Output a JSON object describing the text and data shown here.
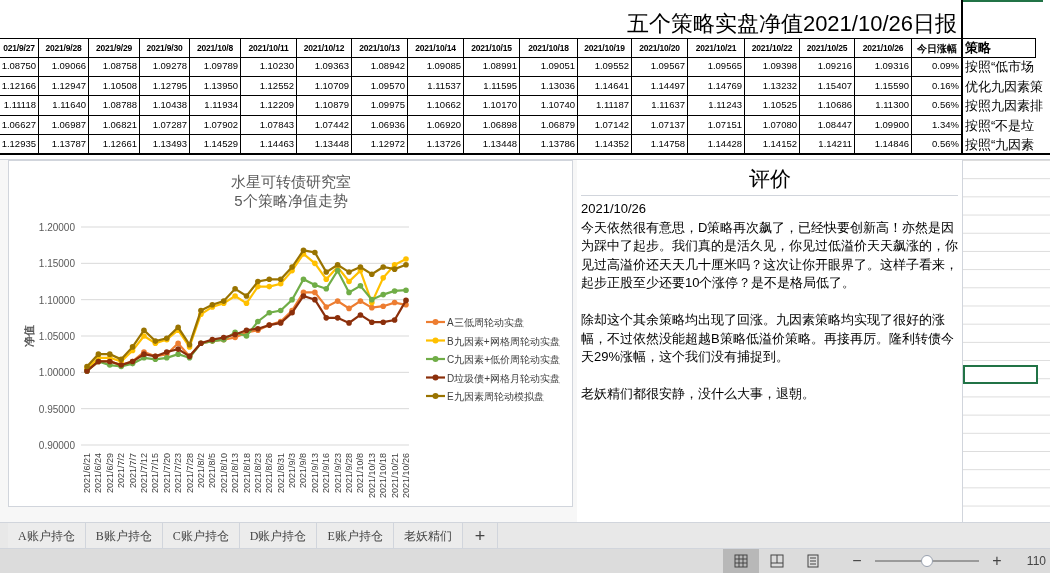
{
  "report": {
    "title": "五个策略实盘净值2021/10/26日报",
    "columns": [
      "021/9/27",
      "2021/9/28",
      "2021/9/29",
      "2021/9/30",
      "2021/10/8",
      "2021/10/11",
      "2021/10/12",
      "2021/10/13",
      "2021/10/14",
      "2021/10/15",
      "2021/10/18",
      "2021/10/19",
      "2021/10/20",
      "2021/10/21",
      "2021/10/22",
      "2021/10/25",
      "2021/10/26",
      "今日涨幅",
      "策略"
    ],
    "rows": [
      {
        "cells": [
          "1.08750",
          "1.09066",
          "1.08758",
          "1.09278",
          "1.09789",
          "1.10230",
          "1.09363",
          "1.08942",
          "1.09085",
          "1.08991",
          "1.09051",
          "1.09552",
          "1.09567",
          "1.09565",
          "1.09398",
          "1.09216",
          "1.09316",
          "0.09%",
          "按照“低市场"
        ]
      },
      {
        "cells": [
          "1.12166",
          "1.12947",
          "1.10508",
          "1.12795",
          "1.13950",
          "1.12552",
          "1.10709",
          "1.09570",
          "1.11537",
          "1.11595",
          "1.13036",
          "1.14641",
          "1.14497",
          "1.14769",
          "1.13232",
          "1.15407",
          "1.15590",
          "0.16%",
          "优化九因素策"
        ]
      },
      {
        "cells": [
          "1.11118",
          "1.11640",
          "1.08788",
          "1.10438",
          "1.11934",
          "1.12209",
          "1.10879",
          "1.09975",
          "1.10662",
          "1.10170",
          "1.10740",
          "1.11187",
          "1.11637",
          "1.11243",
          "1.10525",
          "1.10686",
          "1.11300",
          "0.56%",
          "按照九因素排"
        ]
      },
      {
        "cells": [
          "1.06627",
          "1.06987",
          "1.06821",
          "1.07287",
          "1.07902",
          "1.07843",
          "1.07442",
          "1.06936",
          "1.06920",
          "1.06898",
          "1.06879",
          "1.07142",
          "1.07137",
          "1.07151",
          "1.07080",
          "1.08447",
          "1.09900",
          "1.34%",
          "按照“不是垃"
        ]
      },
      {
        "cells": [
          "1.12935",
          "1.13787",
          "1.12661",
          "1.13493",
          "1.14529",
          "1.14463",
          "1.13448",
          "1.12972",
          "1.13726",
          "1.13448",
          "1.13786",
          "1.14352",
          "1.14758",
          "1.14428",
          "1.14152",
          "1.14211",
          "1.14846",
          "0.56%",
          "按照“九因素"
        ]
      }
    ]
  },
  "chart": {
    "title_lines": [
      "水星可转债研究室",
      "5个策略净值走势"
    ],
    "chart_data": {
      "type": "line",
      "ylabel": "净值",
      "grid": true,
      "legend": true,
      "categories": [
        "2021/6/21",
        "2021/6/24",
        "2021/6/29",
        "2021/7/2",
        "2021/7/7",
        "2021/7/12",
        "2021/7/15",
        "2021/7/20",
        "2021/7/23",
        "2021/7/28",
        "2021/8/2",
        "2021/8/5",
        "2021/8/10",
        "2021/8/13",
        "2021/8/18",
        "2021/8/23",
        "2021/8/26",
        "2021/8/31",
        "2021/9/3",
        "2021/9/8",
        "2021/9/13",
        "2021/9/16",
        "2021/9/23",
        "2021/9/28",
        "2021/10/8",
        "2021/10/13",
        "2021/10/18",
        "2021/10/21",
        "2021/10/26"
      ],
      "ylim": [
        0.9,
        1.2
      ],
      "yticks": [
        {
          "value": 1.2,
          "label": "1.20000"
        },
        {
          "value": 1.15,
          "label": "1.15000"
        },
        {
          "value": 1.1,
          "label": "1.10000"
        },
        {
          "value": 1.05,
          "label": "1.05000"
        },
        {
          "value": 1.0,
          "label": "1.00000"
        },
        {
          "value": 0.95,
          "label": "0.95000"
        },
        {
          "value": 0.9,
          "label": "0.90000"
        }
      ],
      "series": [
        {
          "name": "A三低周轮动实盘",
          "color": "#ed7d31",
          "values": [
            1.002,
            1.015,
            1.015,
            1.01,
            1.015,
            1.028,
            1.022,
            1.025,
            1.04,
            1.022,
            1.04,
            1.043,
            1.045,
            1.048,
            1.055,
            1.058,
            1.065,
            1.07,
            1.085,
            1.11,
            1.11,
            1.09,
            1.098,
            1.088,
            1.098,
            1.089,
            1.091,
            1.096,
            1.093
          ]
        },
        {
          "name": "B九因素+网格周轮动实盘",
          "color": "#ffc000",
          "values": [
            1.005,
            1.02,
            1.02,
            1.015,
            1.03,
            1.05,
            1.04,
            1.045,
            1.058,
            1.035,
            1.08,
            1.09,
            1.095,
            1.105,
            1.095,
            1.118,
            1.118,
            1.122,
            1.14,
            1.163,
            1.15,
            1.128,
            1.145,
            1.125,
            1.14,
            1.096,
            1.13,
            1.148,
            1.156
          ]
        },
        {
          "name": "C九因素+低价周轮动实盘",
          "color": "#70ad47",
          "values": [
            1.002,
            1.015,
            1.01,
            1.008,
            1.012,
            1.02,
            1.018,
            1.02,
            1.025,
            1.02,
            1.04,
            1.043,
            1.045,
            1.055,
            1.05,
            1.07,
            1.082,
            1.085,
            1.1,
            1.128,
            1.12,
            1.115,
            1.14,
            1.11,
            1.119,
            1.1,
            1.107,
            1.112,
            1.113
          ]
        },
        {
          "name": "D垃圾债+网格月轮动实盘",
          "color": "#8b2f0b",
          "values": [
            1.002,
            1.015,
            1.015,
            1.01,
            1.015,
            1.025,
            1.022,
            1.028,
            1.032,
            1.022,
            1.04,
            1.045,
            1.048,
            1.052,
            1.058,
            1.06,
            1.065,
            1.068,
            1.082,
            1.105,
            1.1,
            1.075,
            1.075,
            1.068,
            1.079,
            1.069,
            1.069,
            1.072,
            1.099
          ]
        },
        {
          "name": "E九因素周轮动模拟盘",
          "color": "#997300",
          "values": [
            1.008,
            1.025,
            1.025,
            1.018,
            1.035,
            1.058,
            1.043,
            1.047,
            1.062,
            1.038,
            1.085,
            1.093,
            1.098,
            1.115,
            1.105,
            1.125,
            1.128,
            1.128,
            1.145,
            1.168,
            1.165,
            1.138,
            1.148,
            1.138,
            1.145,
            1.135,
            1.145,
            1.142,
            1.148
          ]
        }
      ]
    }
  },
  "comment": {
    "title": "评价",
    "date": "2021/10/26",
    "paragraphs": [
      "今天依然很有意思，D策略再次飙了，已经快要创新高！亦然是因为踩中了起步。我们真的是活久见，你见过低溢价天天飙涨的，你见过高溢价还天天几十厘米吗？这次让你开眼界了。这样子看来，起步正股至少还要10个涨停？是不是格局低了。",
      "除却这个其余策略均出现了回涨。九因素策略均实现了很好的涨幅，不过依然没能超越B策略低溢价策略。再接再厉。隆利转债今天29%涨幅，这个我们没有捕捉到。",
      "老妖精们都很安静，没什么大事，退朝。"
    ]
  },
  "sheet_tabs": [
    {
      "label": "A账户持仓"
    },
    {
      "label": "B账户持仓"
    },
    {
      "label": "C账户持仓"
    },
    {
      "label": "D账户持仓"
    },
    {
      "label": "E账户持仓"
    },
    {
      "label": "老妖精们"
    }
  ],
  "add_sheet": "+",
  "status_bar": {
    "views": [
      {
        "kind": "normal",
        "selected": true
      },
      {
        "kind": "layout",
        "selected": false
      },
      {
        "kind": "pagebreak",
        "selected": false
      }
    ],
    "zoom_minus": "−",
    "zoom_plus": "+",
    "zoom": {
      "level": 0.5
    },
    "zoom_text": "110"
  }
}
